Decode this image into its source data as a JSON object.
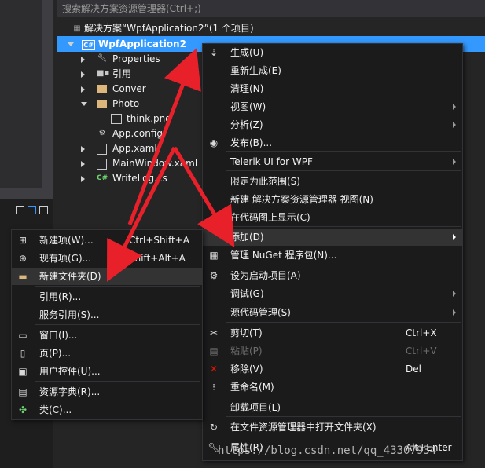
{
  "search": {
    "placeholder": "搜索解决方案资源管理器(Ctrl+;)"
  },
  "tree": {
    "solution": "解决方案“WpfApplication2”(1 个项目)",
    "project": "WpfApplication2",
    "items": [
      {
        "label": "Properties",
        "icon": "wrench-icon"
      },
      {
        "label": "引用",
        "icon": "references-icon"
      },
      {
        "label": "Conver",
        "icon": "folder-icon"
      },
      {
        "label": "Photo",
        "icon": "folder-icon"
      },
      {
        "label": "think.png",
        "icon": "image-icon"
      },
      {
        "label": "App.config",
        "icon": "config-icon"
      },
      {
        "label": "App.xaml",
        "icon": "xaml-icon"
      },
      {
        "label": "MainWindow.xaml",
        "icon": "xaml-icon"
      },
      {
        "label": "WriteLog.cs",
        "icon": "csharp-icon"
      }
    ]
  },
  "context_menu": {
    "items": [
      {
        "label": "生成(U)",
        "icon": "build-icon"
      },
      {
        "label": "重新生成(E)"
      },
      {
        "label": "清理(N)"
      },
      {
        "label": "视图(W)",
        "submenu": true
      },
      {
        "label": "分析(Z)",
        "submenu": true
      },
      {
        "label": "发布(B)...",
        "icon": "publish-icon"
      },
      {
        "label": "Telerik UI for WPF",
        "submenu": true
      },
      {
        "label": "限定为此范围(S)"
      },
      {
        "label": "新建 解决方案资源管理器 视图(N)"
      },
      {
        "label": "在代码图上显示(C)",
        "icon": "code-map-icon"
      },
      {
        "label": "添加(D)",
        "submenu": true
      },
      {
        "label": "管理 NuGet 程序包(N)...",
        "icon": "nuget-icon"
      },
      {
        "label": "设为启动项目(A)",
        "icon": "gear-icon"
      },
      {
        "label": "调试(G)",
        "submenu": true
      },
      {
        "label": "源代码管理(S)",
        "submenu": true
      },
      {
        "label": "剪切(T)",
        "shortcut": "Ctrl+X",
        "icon": "cut-icon"
      },
      {
        "label": "粘贴(P)",
        "shortcut": "Ctrl+V",
        "icon": "paste-icon"
      },
      {
        "label": "移除(V)",
        "shortcut": "Del",
        "icon": "remove-icon"
      },
      {
        "label": "重命名(M)",
        "icon": "rename-icon"
      },
      {
        "label": "卸载项目(L)"
      },
      {
        "label": "在文件资源管理器中打开文件夹(X)",
        "icon": "open-folder-icon"
      },
      {
        "label": "属性(R)",
        "shortcut": "Alt+Enter",
        "icon": "properties-icon"
      }
    ]
  },
  "add_submenu": {
    "items": [
      {
        "label": "新建项(W)...",
        "shortcut": "Ctrl+Shift+A",
        "icon": "new-item-icon"
      },
      {
        "label": "现有项(G)...",
        "shortcut": "Shift+Alt+A",
        "icon": "existing-item-icon"
      },
      {
        "label": "新建文件夹(D)",
        "icon": "new-folder-icon"
      },
      {
        "label": "引用(R)..."
      },
      {
        "label": "服务引用(S)..."
      },
      {
        "label": "窗口(I)...",
        "icon": "window-icon"
      },
      {
        "label": "页(P)...",
        "icon": "page-icon"
      },
      {
        "label": "用户控件(U)...",
        "icon": "user-control-icon"
      },
      {
        "label": "资源字典(R)...",
        "icon": "resource-dictionary-icon"
      },
      {
        "label": "类(C)...",
        "icon": "class-icon"
      }
    ]
  },
  "watermark": "https://blog.csdn.net/qq_43307934",
  "colors": {
    "selection": "#3399ff",
    "arrow": "#e8202a",
    "menu_bg": "#1b1b1c"
  }
}
